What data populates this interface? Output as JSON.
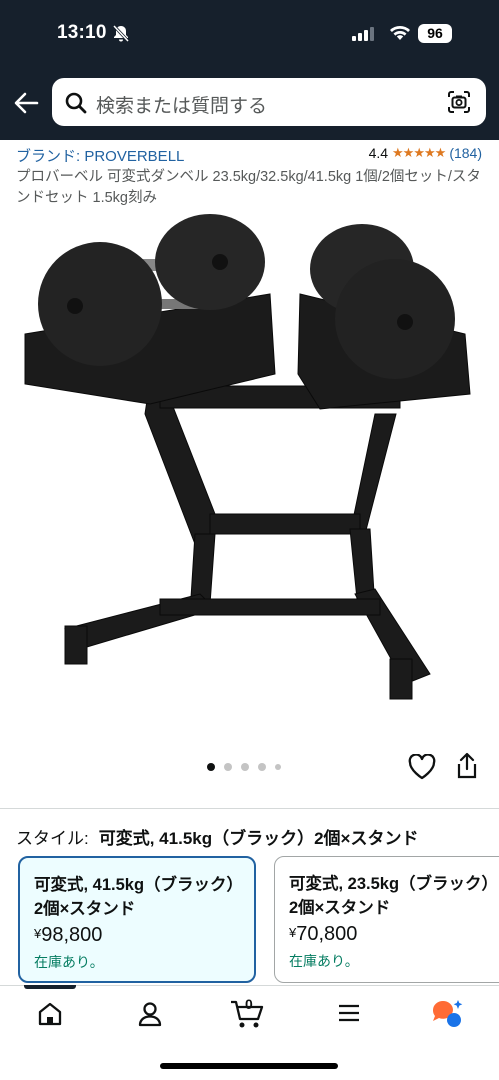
{
  "status_bar": {
    "time": "13:10",
    "battery": "96"
  },
  "search": {
    "placeholder": "検索または質問する"
  },
  "product": {
    "brand": "ブランド: PROVERBELL",
    "rating_value": "4.4",
    "rating_stars": "★★★★★",
    "rating_count": "(184)",
    "title": "プロバーベル 可変式ダンベル 23.5kg/32.5kg/41.5kg 1個/2個セット/スタンドセット 1.5kg刻み"
  },
  "gallery": {
    "dot_count": 5,
    "active_index": 0
  },
  "style": {
    "label": "スタイル:",
    "selected_value": "可変式, 41.5kg（ブラック）2個×スタンド",
    "options": [
      {
        "name": "可変式, 41.5kg（ブラック）2個×スタンド",
        "currency": "¥",
        "price": "98,800",
        "stock": "在庫あり。"
      },
      {
        "name": "可変式, 23.5kg（ブラック）2個×スタンド",
        "currency": "¥",
        "price": "70,800",
        "stock": "在庫あり。"
      }
    ]
  },
  "bottom_nav": {
    "cart_count": "0"
  },
  "colors": {
    "header_bg": "#16202c",
    "link": "#2162a1",
    "star": "#de7921",
    "in_stock": "#067d62",
    "selected_border": "#2162a1"
  }
}
